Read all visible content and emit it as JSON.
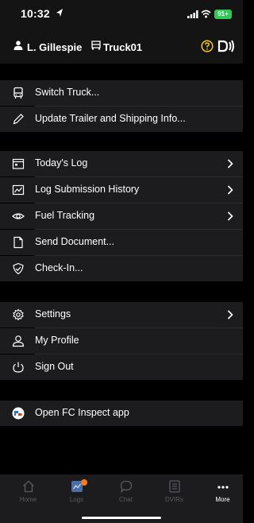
{
  "status_bar": {
    "time": "10:32",
    "battery": "91+"
  },
  "header": {
    "user": "L. Gillespie",
    "truck": "Truck01"
  },
  "menu": {
    "switch_truck": "Switch Truck...",
    "update_trailer": "Update Trailer and Shipping Info...",
    "todays_log": "Today's Log",
    "log_submission_history": "Log Submission History",
    "fuel_tracking": "Fuel Tracking",
    "send_document": "Send Document...",
    "check_in": "Check-In...",
    "settings": "Settings",
    "my_profile": "My Profile",
    "sign_out": "Sign Out",
    "open_fc_inspect": "Open FC Inspect app"
  },
  "tabs": {
    "home": "Home",
    "logs": "Logs",
    "chat": "Chat",
    "dvirs": "DVIRs",
    "more": "More"
  },
  "colors": {
    "accent_battery": "#35c759",
    "help_icon": "#f0c419",
    "badge": "#ff7a1a"
  },
  "icons": [
    "location-arrow-icon",
    "signal-bars-icon",
    "wifi-icon",
    "user-icon",
    "truck-icon",
    "help-icon",
    "connection-signal-icon",
    "bus-icon",
    "pencil-icon",
    "calendar-icon",
    "chart-icon",
    "eye-icon",
    "document-icon",
    "check-shield-icon",
    "gear-icon",
    "person-icon",
    "power-icon",
    "fc-inspect-icon",
    "chevron-right-icon",
    "home-icon",
    "logs-icon",
    "chat-icon",
    "dvirs-icon",
    "more-icon"
  ]
}
